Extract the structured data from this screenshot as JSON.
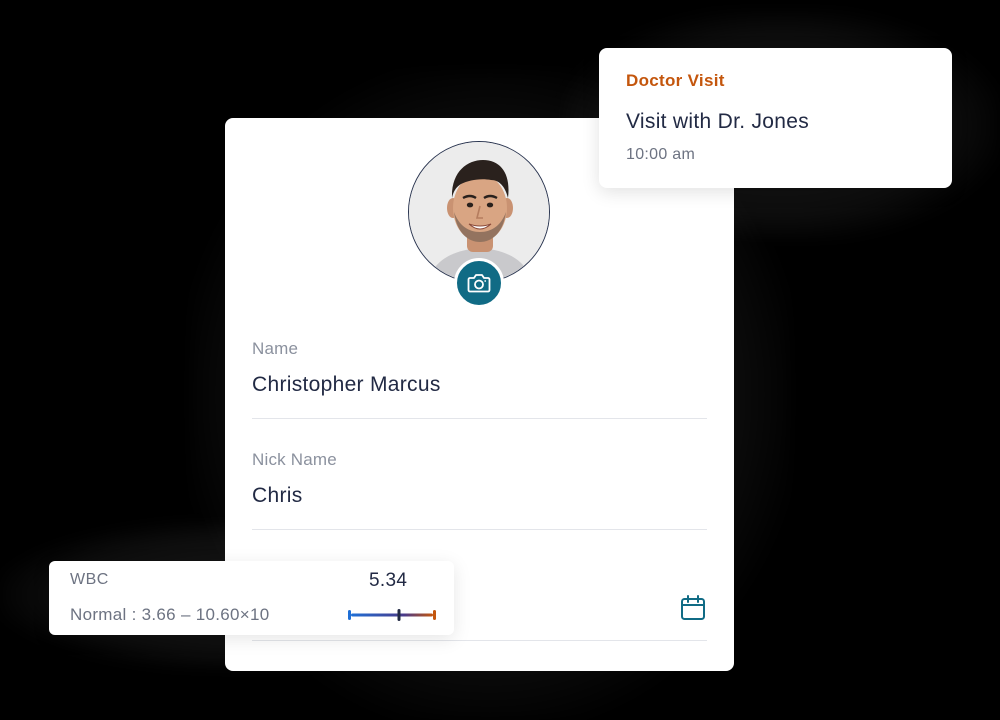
{
  "profile": {
    "fields": [
      {
        "label": "Name",
        "value": "Christopher Marcus"
      },
      {
        "label": "Nick Name",
        "value": "Chris"
      }
    ],
    "avatar_icon": "person-photo",
    "camera_icon": "camera-icon",
    "calendar_icon": "calendar-icon",
    "accent_color": "#106b85"
  },
  "visit": {
    "tag": "Doctor Visit",
    "title": "Visit with Dr. Jones",
    "time": "10:00 am",
    "tag_color": "#c4560d"
  },
  "wbc": {
    "label": "WBC",
    "value": "5.34",
    "range_text": "Normal : 3.66 – 10.60×10",
    "range_min": 3.66,
    "range_max": 10.6,
    "reading": 5.34
  }
}
